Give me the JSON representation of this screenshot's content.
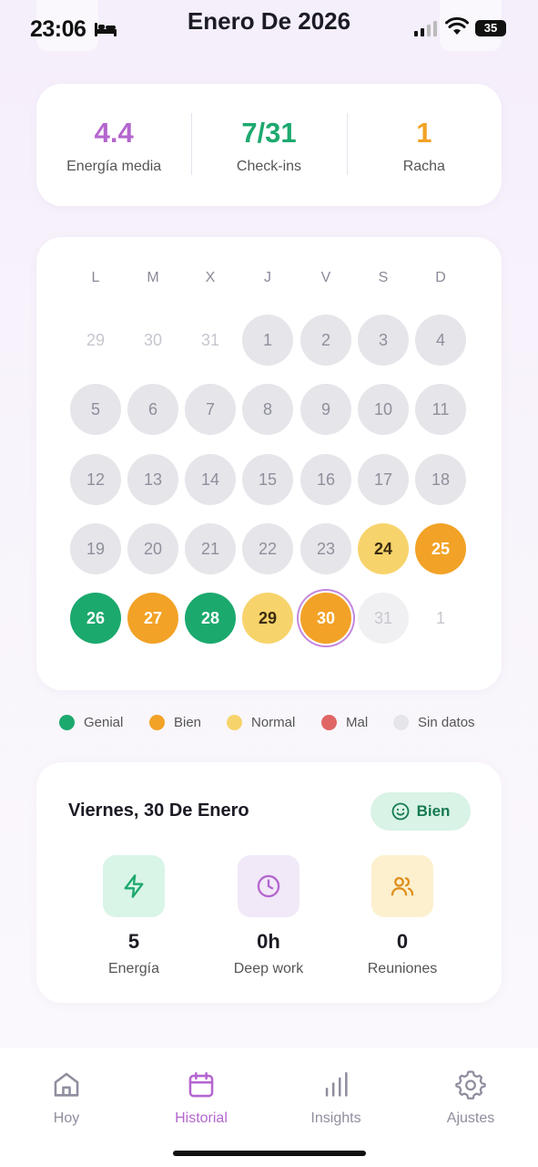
{
  "status_bar": {
    "time": "23:06",
    "battery": "35"
  },
  "header": {
    "title": "Enero De 2026"
  },
  "stats": [
    {
      "value": "4.4",
      "label": "Energía media",
      "color": "#b466cf"
    },
    {
      "value": "7/31",
      "label": "Check-ins",
      "color": "#1ca96e"
    },
    {
      "value": "1",
      "label": "Racha",
      "color": "#f2a226"
    }
  ],
  "calendar": {
    "weekdays": [
      "L",
      "M",
      "X",
      "J",
      "V",
      "S",
      "D"
    ],
    "weeks": [
      [
        {
          "d": "29",
          "s": "outside"
        },
        {
          "d": "30",
          "s": "outside"
        },
        {
          "d": "31",
          "s": "outside"
        },
        {
          "d": "1",
          "s": "nodata"
        },
        {
          "d": "2",
          "s": "nodata"
        },
        {
          "d": "3",
          "s": "nodata"
        },
        {
          "d": "4",
          "s": "nodata"
        }
      ],
      [
        {
          "d": "5",
          "s": "nodata"
        },
        {
          "d": "6",
          "s": "nodata"
        },
        {
          "d": "7",
          "s": "nodata"
        },
        {
          "d": "8",
          "s": "nodata"
        },
        {
          "d": "9",
          "s": "nodata"
        },
        {
          "d": "10",
          "s": "nodata"
        },
        {
          "d": "11",
          "s": "nodata"
        }
      ],
      [
        {
          "d": "12",
          "s": "nodata"
        },
        {
          "d": "13",
          "s": "nodata"
        },
        {
          "d": "14",
          "s": "nodata"
        },
        {
          "d": "15",
          "s": "nodata"
        },
        {
          "d": "16",
          "s": "nodata"
        },
        {
          "d": "17",
          "s": "nodata"
        },
        {
          "d": "18",
          "s": "nodata"
        }
      ],
      [
        {
          "d": "19",
          "s": "nodata"
        },
        {
          "d": "20",
          "s": "nodata"
        },
        {
          "d": "21",
          "s": "nodata"
        },
        {
          "d": "22",
          "s": "nodata"
        },
        {
          "d": "23",
          "s": "nodata"
        },
        {
          "d": "24",
          "s": "normal"
        },
        {
          "d": "25",
          "s": "bien"
        }
      ],
      [
        {
          "d": "26",
          "s": "genial"
        },
        {
          "d": "27",
          "s": "bien"
        },
        {
          "d": "28",
          "s": "genial"
        },
        {
          "d": "29",
          "s": "normal"
        },
        {
          "d": "30",
          "s": "bien",
          "selected": true
        },
        {
          "d": "31",
          "s": "future"
        },
        {
          "d": "1",
          "s": "outside"
        }
      ]
    ]
  },
  "legend": [
    {
      "label": "Genial",
      "color": "#1ca96e"
    },
    {
      "label": "Bien",
      "color": "#f2a226"
    },
    {
      "label": "Normal",
      "color": "#f7d36b"
    },
    {
      "label": "Mal",
      "color": "#e06666"
    },
    {
      "label": "Sin datos",
      "color": "#e5e5ea"
    }
  ],
  "detail": {
    "date": "Viernes, 30 De Enero",
    "mood": "Bien",
    "metrics": [
      {
        "icon": "lightning-icon",
        "value": "5",
        "label": "Energía",
        "bg": "#d9f5e7",
        "fg": "#1ca96e"
      },
      {
        "icon": "clock-icon",
        "value": "0h",
        "label": "Deep work",
        "bg": "#f1e8f8",
        "fg": "#b466cf"
      },
      {
        "icon": "users-icon",
        "value": "0",
        "label": "Reuniones",
        "bg": "#fdf0cf",
        "fg": "#e08f1c"
      }
    ]
  },
  "tabs": [
    {
      "label": "Hoy",
      "icon": "home-icon",
      "active": false
    },
    {
      "label": "Historial",
      "icon": "calendar-icon",
      "active": true
    },
    {
      "label": "Insights",
      "icon": "bar-chart-icon",
      "active": false
    },
    {
      "label": "Ajustes",
      "icon": "gear-icon",
      "active": false
    }
  ]
}
